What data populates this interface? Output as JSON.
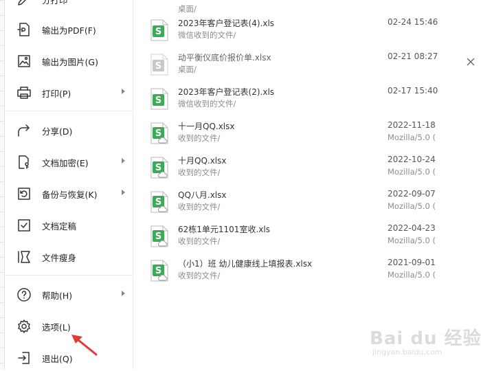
{
  "menu": {
    "items": [
      {
        "label": "分打印"
      },
      {
        "label": "输出为PDF(F)"
      },
      {
        "label": "输出为图片(G)"
      },
      {
        "label": "打印(P)"
      },
      {
        "label": "分享(D)"
      },
      {
        "label": "文档加密(E)"
      },
      {
        "label": "备份与恢复(K)"
      },
      {
        "label": "文档定稿"
      },
      {
        "label": "文件瘦身"
      },
      {
        "label": "帮助(H)"
      },
      {
        "label": "选项(L)"
      },
      {
        "label": "退出(Q)"
      }
    ]
  },
  "files": [
    {
      "name": "",
      "path": "桌面/",
      "date": "",
      "source": ""
    },
    {
      "name": "2023年客户登记表(4).xls",
      "path": "微信收到的文件/",
      "date": "02-24 15:46",
      "source": ""
    },
    {
      "name": "动平衡仪底价报价单.xlsx",
      "path": "桌面/",
      "date": "02-21 08:27",
      "source": ""
    },
    {
      "name": "2023年客户登记表(2).xls",
      "path": "微信收到的文件/",
      "date": "02-17 15:40",
      "source": ""
    },
    {
      "name": "十一月QQ.xlsx",
      "path": "收到的文件/",
      "date": "2022-11-18",
      "source": "Mozilla/5.0 ("
    },
    {
      "name": "十月QQ.xlsx",
      "path": "收到的文件/",
      "date": "2022-10-24",
      "source": "Mozilla/5.0 ("
    },
    {
      "name": "QQ八月.xlsx",
      "path": "收到的文件/",
      "date": "2022-09-07",
      "source": "Mozilla/5.0 ("
    },
    {
      "name": "62栋1单元1101室收.xls",
      "path": "收到的文件/",
      "date": "2022-04-23",
      "source": "Mozilla/5.0 ("
    },
    {
      "name": "（小1）班 幼儿健康线上填报表.xlsx",
      "path": "收到的文件/",
      "date": "2021-09-01",
      "source": "Mozilla/5.0 ("
    }
  ],
  "watermark": {
    "brand": "Bai du 经验",
    "site": "jingyan.baidu.com"
  },
  "colors": {
    "spreadsheet_green": "#3daa57",
    "dim_icon": "#c8c8c8",
    "arrow_red": "#e03b3b"
  }
}
